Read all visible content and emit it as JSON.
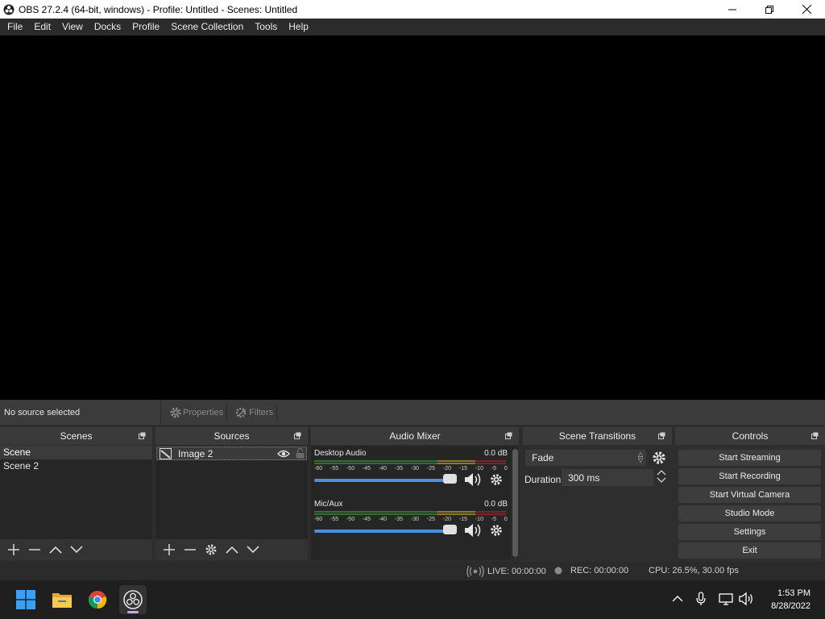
{
  "window": {
    "title": "OBS 27.2.4 (64-bit, windows) - Profile: Untitled - Scenes: Untitled"
  },
  "menu": [
    "File",
    "Edit",
    "View",
    "Docks",
    "Profile",
    "Scene Collection",
    "Tools",
    "Help"
  ],
  "source_toolbar": {
    "status": "No source selected",
    "properties": "Properties",
    "filters": "Filters"
  },
  "scenes": {
    "title": "Scenes",
    "items": [
      "Scene",
      "Scene 2"
    ]
  },
  "sources": {
    "title": "Sources",
    "items": [
      "Image 2"
    ]
  },
  "mixer": {
    "title": "Audio Mixer",
    "channels": [
      {
        "name": "Desktop Audio",
        "db": "0.0 dB"
      },
      {
        "name": "Mic/Aux",
        "db": "0.0 dB"
      }
    ],
    "ticks": [
      "-60",
      "-55",
      "-50",
      "-45",
      "-40",
      "-35",
      "-30",
      "-25",
      "-20",
      "-15",
      "-10",
      "-5",
      "0"
    ]
  },
  "transitions": {
    "title": "Scene Transitions",
    "selected": "Fade",
    "duration_label": "Duration",
    "duration_value": "300 ms"
  },
  "controls": {
    "title": "Controls",
    "buttons": [
      "Start Streaming",
      "Start Recording",
      "Start Virtual Camera",
      "Studio Mode",
      "Settings",
      "Exit"
    ]
  },
  "status": {
    "live": "LIVE: 00:00:00",
    "rec": "REC: 00:00:00",
    "cpu": "CPU: 26.5%, 30.00 fps"
  },
  "clock": {
    "time": "1:53 PM",
    "date": "8/28/2022"
  },
  "colors": {
    "accent": "#4a8fde",
    "panel": "#2e2e2e",
    "list": "#262626"
  }
}
